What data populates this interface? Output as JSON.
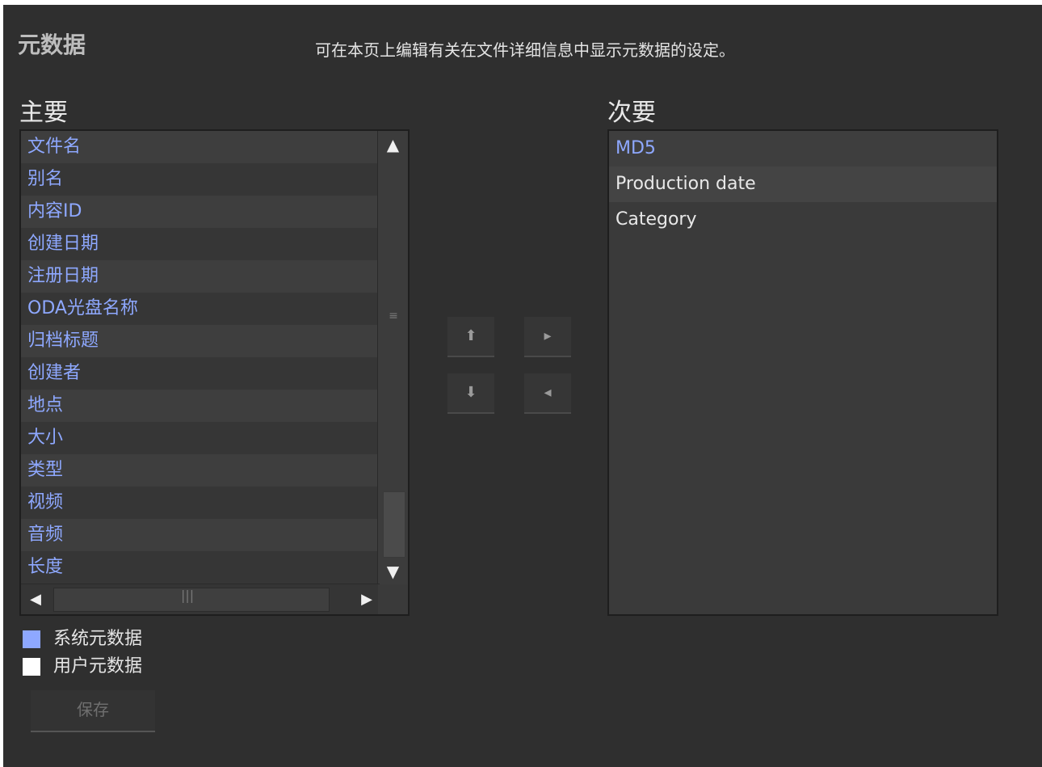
{
  "header": {
    "title": "元数据",
    "description": "可在本页上编辑有关在文件详细信息中显示元数据的设定。"
  },
  "primary": {
    "label": "主要",
    "items": [
      "文件名",
      "别名",
      "内容ID",
      "创建日期",
      "注册日期",
      "ODA光盘名称",
      "归档标题",
      "创建者",
      "地点",
      "大小",
      "类型",
      "视频",
      "音频",
      "长度"
    ]
  },
  "secondary": {
    "label": "次要",
    "items": [
      "MD5",
      "Production date",
      "Category"
    ]
  },
  "legend": {
    "system": "系统元数据",
    "user": "用户元数据",
    "system_color": "#8ea8ff",
    "user_color": "#ffffff"
  },
  "buttons": {
    "move_up_icon": "arrow-up-icon",
    "move_right_icon": "arrow-right-icon",
    "move_down_icon": "arrow-down-icon",
    "move_left_icon": "arrow-left-icon",
    "save": "保存"
  },
  "colors": {
    "background": "#2f2f2f",
    "system_text": "#8ea8ff"
  }
}
